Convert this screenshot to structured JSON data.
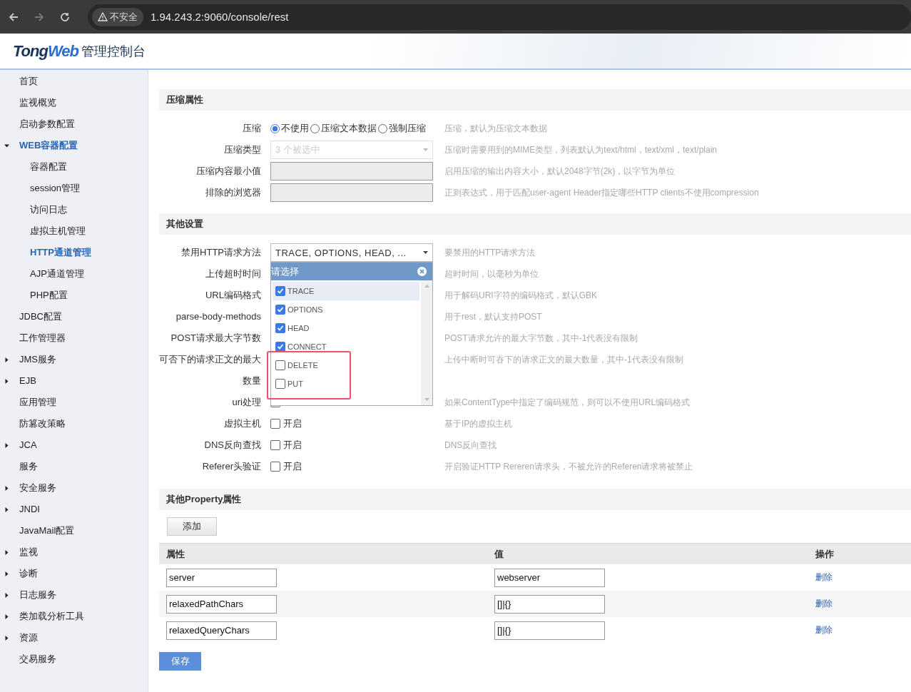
{
  "browser": {
    "security_label": "不安全",
    "url": "1.94.243.2:9060/console/rest"
  },
  "header": {
    "logo_parts": [
      "Tong",
      "Web"
    ],
    "title": "管理控制台"
  },
  "sidebar": {
    "items": [
      {
        "label": "首页",
        "kind": "link",
        "selected": false
      },
      {
        "label": "监视概览",
        "kind": "link",
        "selected": false
      },
      {
        "label": "启动参数配置",
        "kind": "link",
        "selected": false
      },
      {
        "label": "WEB容器配置",
        "kind": "group",
        "expanded": true,
        "children": [
          {
            "label": "容器配置",
            "selected": false
          },
          {
            "label": "session管理",
            "selected": false
          },
          {
            "label": "访问日志",
            "selected": false
          },
          {
            "label": "虚拟主机管理",
            "selected": false
          },
          {
            "label": "HTTP通道管理",
            "selected": true
          },
          {
            "label": "AJP通道管理",
            "selected": false
          },
          {
            "label": "PHP配置",
            "selected": false
          }
        ]
      },
      {
        "label": "JDBC配置",
        "kind": "link",
        "selected": false
      },
      {
        "label": "工作管理器",
        "kind": "link",
        "selected": false
      },
      {
        "label": "JMS服务",
        "kind": "group",
        "expanded": false
      },
      {
        "label": "EJB",
        "kind": "group",
        "expanded": false
      },
      {
        "label": "应用管理",
        "kind": "link",
        "selected": false
      },
      {
        "label": "防篡改策略",
        "kind": "link",
        "selected": false
      },
      {
        "label": "JCA",
        "kind": "group",
        "expanded": false
      },
      {
        "label": "服务",
        "kind": "link",
        "selected": false
      },
      {
        "label": "安全服务",
        "kind": "group",
        "expanded": false
      },
      {
        "label": "JNDI",
        "kind": "group",
        "expanded": false
      },
      {
        "label": "JavaMail配置",
        "kind": "link",
        "selected": false
      },
      {
        "label": "监视",
        "kind": "group",
        "expanded": false
      },
      {
        "label": "诊断",
        "kind": "group",
        "expanded": false
      },
      {
        "label": "日志服务",
        "kind": "group",
        "expanded": false
      },
      {
        "label": "类加载分析工具",
        "kind": "group",
        "expanded": false
      },
      {
        "label": "资源",
        "kind": "group",
        "expanded": false
      },
      {
        "label": "交易服务",
        "kind": "link",
        "selected": false
      }
    ]
  },
  "sections": [
    {
      "title": "压缩属性",
      "rows": [
        {
          "label": "压缩",
          "kind": "radio",
          "options": [
            {
              "label": "不使用",
              "selected": true
            },
            {
              "label": "压缩文本数据",
              "selected": false
            },
            {
              "label": "强制压缩",
              "selected": false
            }
          ],
          "description": "压缩，默认为压缩文本数据"
        },
        {
          "label": "压缩类型",
          "kind": "select",
          "value": "3 个被选中",
          "disabled": true,
          "description": "压缩时需要用到的MIME类型，列表默认为text/html，text/xml，text/plain"
        },
        {
          "label": "压缩内容最小值",
          "kind": "text",
          "disabled": true,
          "description": "启用压缩的输出内容大小，默认2048字节(2k)，以字节为单位"
        },
        {
          "label": "排除的浏览器",
          "kind": "text",
          "disabled": true,
          "description": "正则表达式，用于匹配user-agent Header指定哪些HTTP clients不使用compression"
        }
      ]
    },
    {
      "title": "其他设置",
      "rows": [
        {
          "label": "禁用HTTP请求方法",
          "kind": "multiselect",
          "value": "TRACE, OPTIONS, HEAD, ...",
          "description": "要禁用的HTTP请求方法",
          "dropdown": {
            "header": "请选择",
            "options": [
              {
                "label": "TRACE",
                "checked": true,
                "highlighted": true
              },
              {
                "label": "OPTIONS",
                "checked": true,
                "highlighted": false
              },
              {
                "label": "HEAD",
                "checked": true,
                "highlighted": false
              },
              {
                "label": "CONNECT",
                "checked": true,
                "highlighted": false
              },
              {
                "label": "DELETE",
                "checked": false,
                "highlighted": false
              },
              {
                "label": "PUT",
                "checked": false,
                "highlighted": false
              }
            ]
          }
        },
        {
          "label": "上传超时时间",
          "kind": "covered",
          "description": "超时时间，以毫秒为单位"
        },
        {
          "label": "URL编码格式",
          "kind": "covered",
          "description": "用于解码URI字符的编码格式，默认GBK"
        },
        {
          "label": "parse-body-methods",
          "kind": "covered",
          "description": "用于rest，默认支持POST"
        },
        {
          "label": "POST请求最大字节数",
          "kind": "covered",
          "description": "POST请求允许的最大字节数，其中-1代表没有限制"
        },
        {
          "label": "可否下的请求正文的最大数量",
          "kind": "covered",
          "description": "上传中断时可吞下的请求正文的最大数量，其中-1代表没有限制"
        },
        {
          "label": "uri处理",
          "kind": "checkbox",
          "checked": false,
          "description": "如果ContentType中指定了编码规范，则可以不使用URL编码格式"
        },
        {
          "label": "虚拟主机",
          "kind": "checkbox",
          "checked": false,
          "option": "开启",
          "description": "基于IP的虚拟主机"
        },
        {
          "label": "DNS反向查找",
          "kind": "checkbox",
          "checked": false,
          "option": "开启",
          "description": "DNS反向查找"
        },
        {
          "label": "Referer头验证",
          "kind": "checkbox",
          "checked": false,
          "option": "开启",
          "description": "开启验证HTTP Rereren请求头，不被允许的Referen请求将被禁止"
        }
      ]
    }
  ],
  "properties": {
    "title": "其他Property属性",
    "add_button": "添加",
    "columns": [
      "属性",
      "值",
      "操作"
    ],
    "rows": [
      {
        "name": "server",
        "value": "webserver",
        "action": "删除"
      },
      {
        "name": "relaxedPathChars",
        "value": "[]|{}",
        "action": "删除"
      },
      {
        "name": "relaxedQueryChars",
        "value": "[]|{}",
        "action": "删除"
      }
    ],
    "save_button": "保存"
  }
}
